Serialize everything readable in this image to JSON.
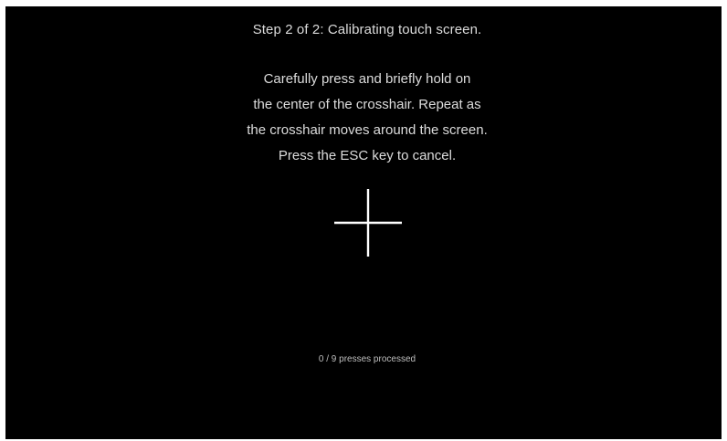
{
  "calibration": {
    "step_title": "Step 2 of 2: Calibrating touch screen.",
    "instructions": [
      "Carefully press and briefly hold on",
      "the center of the crosshair. Repeat as",
      "the crosshair moves around the screen.",
      "Press the ESC key to cancel."
    ],
    "progress_text": "0 / 9 presses processed",
    "crosshair_icon": "crosshair-icon",
    "colors": {
      "background": "#000000",
      "text": "#dcdcdc",
      "crosshair": "#ffffff"
    }
  }
}
